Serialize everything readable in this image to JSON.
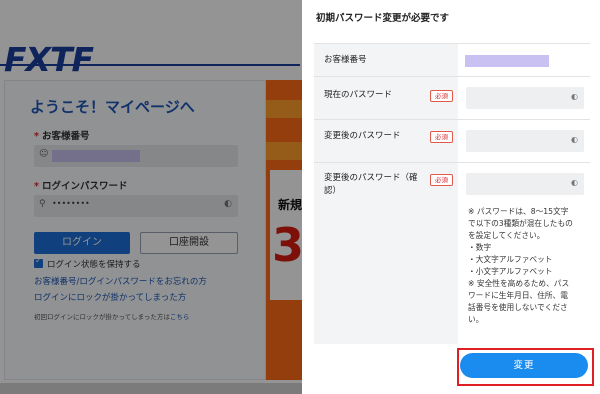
{
  "background": {
    "logo": "FXTF",
    "welcome": "ようこそ！マイページへ",
    "customer_no_label": "お客様番号",
    "login_password_label": "ログインパスワード",
    "password_mask": "••••••••",
    "login_button": "ログイン",
    "open_account_button": "口座開設",
    "remember_label": "ログイン状態を保持する",
    "forgot_link": "お客様番号/ログインパスワードをお忘れの方",
    "locked_link": "ログインにロックが掛かってしまった方",
    "first_login_note": "初回ログインにロックが掛かってしまった方は",
    "first_login_note_link": "こちら",
    "banner_text": "新規",
    "banner_number": "3",
    "required_mark": "*"
  },
  "modal": {
    "title": "初期パスワード変更が必要です",
    "rows": [
      {
        "label": "お客様番号",
        "required": false
      },
      {
        "label": "現在のパスワード",
        "required": true
      },
      {
        "label": "変更後のパスワード",
        "required": true
      },
      {
        "label": "変更後のパスワード（確認）",
        "required": true
      }
    ],
    "required_badge": "必須",
    "password_rules": [
      "※ パスワードは、8〜15文字",
      "で以下の3種類が混在したもの",
      "を設定してください。",
      "・数字",
      "・大文字アルファベット",
      "・小文字アルファベット",
      "※ 安全性を高めるため、パス",
      "ワードに生年月日、住所、電",
      "話番号を使用しないでくださ",
      "い。"
    ],
    "submit_button": "変更"
  },
  "colors": {
    "brand_blue": "#1a3f9c",
    "primary_button": "#1a8cf0",
    "required_red": "#d8262d",
    "highlight_frame": "#e01f24",
    "masked_value": "#c9c1f2"
  },
  "icons": {
    "user": "user-icon",
    "key": "key-icon",
    "eye": "eye-slash-icon"
  }
}
